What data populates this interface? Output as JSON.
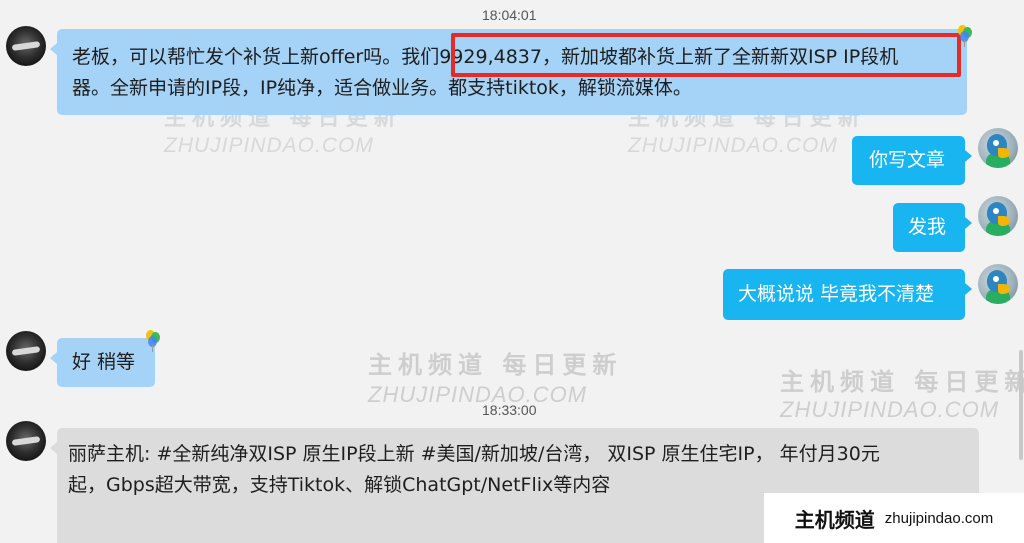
{
  "timestamps": [
    "18:04:01",
    "18:33:00"
  ],
  "messages": {
    "m1": {
      "line1_before": "老板，可以帮忙发个补货上新offer吗。我",
      "line1_highlight": "们9929,4837，新加坡都补货上新了全新新双ISP IP段机",
      "line2": "器。全新申请的IP段，IP纯净，适合做业务。都支持tiktok，解锁流媒体。"
    },
    "m2": "你写文章",
    "m3": "发我",
    "m4": "大概说说 毕竟我不清楚",
    "m5": "好 稍等",
    "m6": {
      "line1": "丽萨主机: #全新纯净双ISP 原生IP段上新 #美国/新加坡/台湾， 双ISP 原生住宅IP， 年付月30元",
      "line2": "起，Gbps超大带宽，支持Tiktok、解锁ChatGpt/NetFlix等内容"
    }
  },
  "watermark": {
    "cn": "主机频道 每日更新",
    "en": "ZHUJIPINDAO.COM"
  },
  "site_badge": {
    "name": "主机频道",
    "domain": "zhujipindao.com"
  },
  "colors": {
    "incoming_bubble": "#a5d2f7",
    "outgoing_bubble": "#18b5f0",
    "highlight": "#e52a2a"
  }
}
